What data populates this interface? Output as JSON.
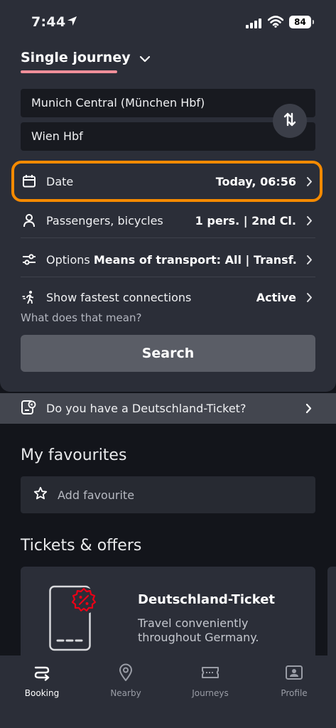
{
  "status_bar": {
    "time": "7:44",
    "battery": "84"
  },
  "journey": {
    "type_label": "Single journey",
    "from": "Munich Central (München Hbf)",
    "to": "Wien Hbf"
  },
  "date_row": {
    "label": "Date",
    "value": "Today, 06:56"
  },
  "passengers_row": {
    "label": "Passengers, bicycles",
    "value": "1 pers. | 2nd Cl."
  },
  "options_row": {
    "label": "Options",
    "value": "Means of transport: All | Transf..."
  },
  "fastest_row": {
    "label": "Show fastest connections",
    "value": "Active",
    "help": "What does that mean?"
  },
  "search_button": "Search",
  "dt_banner": "Do you have a Deutschland-Ticket?",
  "favourites": {
    "title": "My favourites",
    "add_label": "Add favourite"
  },
  "offers": {
    "title": "Tickets & offers",
    "card_title": "Deutschland-Ticket",
    "card_desc": "Travel conveniently throughout Germany."
  },
  "tabs": [
    {
      "label": "Booking",
      "icon": "route-icon",
      "active": true
    },
    {
      "label": "Nearby",
      "icon": "location-pin-icon",
      "active": false
    },
    {
      "label": "Journeys",
      "icon": "ticket-icon",
      "active": false
    },
    {
      "label": "Profile",
      "icon": "profile-icon",
      "active": false
    }
  ],
  "colors": {
    "highlight": "#f58a00",
    "accent_underline": "#f08f9a",
    "badge_red": "#ec0016"
  }
}
